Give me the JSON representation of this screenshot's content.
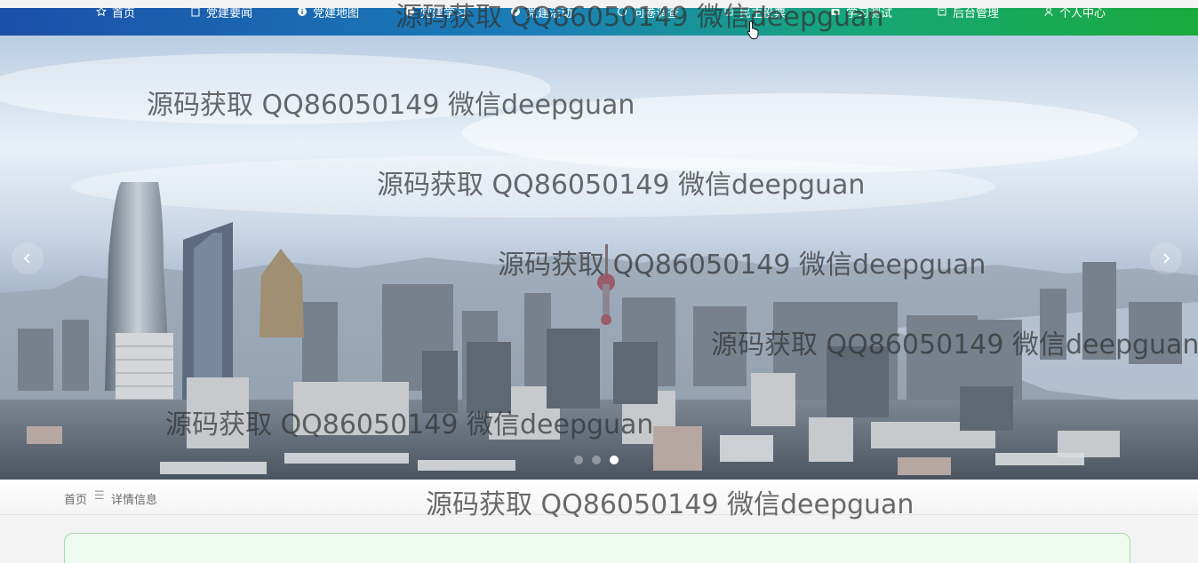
{
  "nav": {
    "items": [
      {
        "label": "首页",
        "icon": "star-icon"
      },
      {
        "label": "党建要闻",
        "icon": "news-icon"
      },
      {
        "label": "党建地图",
        "icon": "info-icon"
      },
      {
        "label": "党建学习",
        "icon": "study-icon"
      },
      {
        "label": "党建活动",
        "icon": "compass-icon"
      },
      {
        "label": "问卷调查",
        "icon": "survey-icon"
      },
      {
        "label": "民主投票",
        "icon": "vote-icon"
      },
      {
        "label": "学习测试",
        "icon": "camera-icon"
      },
      {
        "label": "后台管理",
        "icon": "admin-icon"
      },
      {
        "label": "个人中心",
        "icon": "user-icon"
      }
    ]
  },
  "banner": {
    "prev_icon": "chevron-left-icon",
    "next_icon": "chevron-right-icon",
    "slides": 3,
    "active_slide": 3
  },
  "breadcrumb": {
    "home": "首页",
    "separator": "☰",
    "current": "详情信息"
  },
  "watermark": {
    "text": "源码获取 QQ86050149 微信deepguan"
  },
  "colors": {
    "nav_start": "#1b4fa8",
    "nav_end": "#1aaa3a",
    "card_bg": "#effbf0",
    "card_border": "#9fdca8"
  }
}
